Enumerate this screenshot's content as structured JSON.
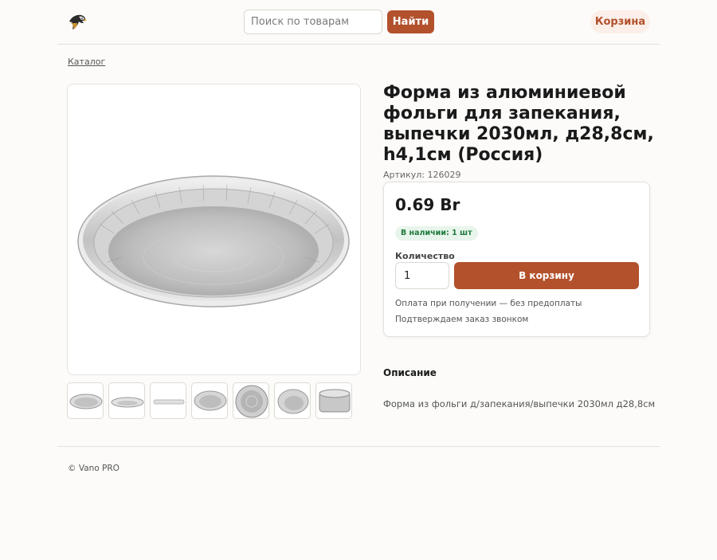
{
  "header": {
    "logo_icon": "eagle-logo-icon",
    "search": {
      "placeholder": "Поиск по товарам",
      "value": ""
    },
    "search_button": "Найти",
    "cart_label": "Корзина"
  },
  "breadcrumb": "Каталог",
  "product": {
    "title": "Форма из алюминиевой фольги для запекания, выпечки 2030мл, д28,8см, h4,1см (Россия)",
    "sku": "Артикул: 126029",
    "price": "0.69 Br",
    "stock": "В наличии: 1 шт",
    "quantity_label": "Количество",
    "quantity_value": "1",
    "add_to_cart": "В корзину",
    "notes": [
      "Оплата при получении — без предоплаты",
      "Подтверждаем заказ звонком"
    ],
    "description_heading": "Описание",
    "description": "Форма из фольги д/запекания/выпечки 2030мл д28,8см",
    "thumbnail_count": 7
  },
  "footer": {
    "copyright": "© Vano PRO"
  },
  "colors": {
    "accent": "#b2512c",
    "background": "#fcfbf9",
    "stock_green": "#1e7a3c",
    "stock_bg": "#e8f5ec"
  }
}
